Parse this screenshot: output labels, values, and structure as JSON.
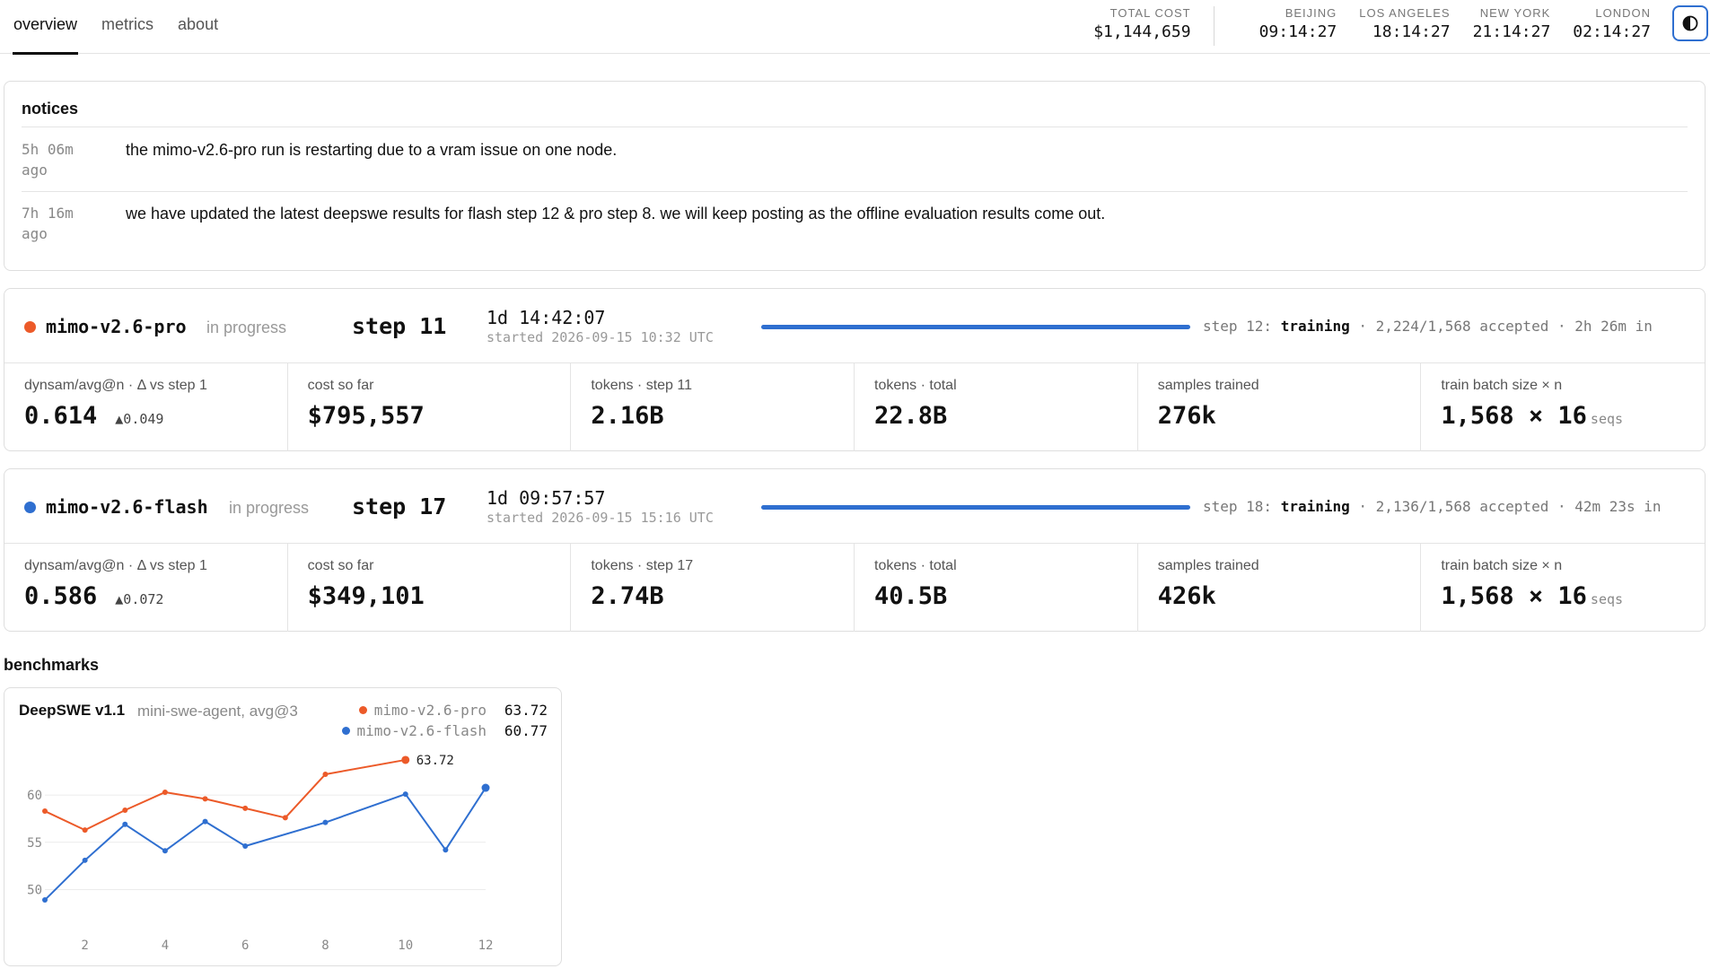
{
  "nav": {
    "tabs": [
      {
        "label": "overview",
        "active": true
      },
      {
        "label": "metrics",
        "active": false
      },
      {
        "label": "about",
        "active": false
      }
    ]
  },
  "header": {
    "total_cost_label": "TOTAL COST",
    "total_cost_value": "$1,144,659",
    "clocks": [
      {
        "label": "BEIJING",
        "time": "09:14:27"
      },
      {
        "label": "LOS ANGELES",
        "time": "18:14:27"
      },
      {
        "label": "NEW YORK",
        "time": "21:14:27"
      },
      {
        "label": "LONDON",
        "time": "02:14:27"
      }
    ],
    "theme_toggle_icon": "half-circle-contrast-icon"
  },
  "notices": {
    "title": "notices",
    "items": [
      {
        "time": "5h 06m ago",
        "text": "the mimo-v2.6-pro run is restarting due to a vram issue on one node."
      },
      {
        "time": "7h 16m ago",
        "text": "we have updated the latest deepswe results for flash step 12 & pro step 8. we will keep posting as the offline evaluation results come out."
      }
    ]
  },
  "runs": [
    {
      "name": "mimo-v2.6-pro",
      "dot_color": "#ec5a29",
      "status": "in progress",
      "step": "step 11",
      "elapsed": "1d 14:42:07",
      "started": "started 2026-09-15 10:32 UTC",
      "progress_fraction": 1.0,
      "progress_prefix": "step 12:",
      "progress_phase": "training",
      "progress_suffix": "· 2,224/1,568 accepted · 2h 26m in",
      "metrics": [
        {
          "label": "dynsam/avg@n · Δ vs step 1",
          "value": "0.614",
          "delta": "▲0.049"
        },
        {
          "label": "cost so far",
          "value": "$795,557"
        },
        {
          "label": "tokens · step 11",
          "value": "2.16B"
        },
        {
          "label": "tokens · total",
          "value": "22.8B"
        },
        {
          "label": "samples trained",
          "value": "276k"
        },
        {
          "label": "train batch size × n",
          "value": "1,568 × 16",
          "unit": "seqs"
        }
      ]
    },
    {
      "name": "mimo-v2.6-flash",
      "dot_color": "#2f6fd0",
      "status": "in progress",
      "step": "step 17",
      "elapsed": "1d 09:57:57",
      "started": "started 2026-09-15 15:16 UTC",
      "progress_fraction": 1.0,
      "progress_prefix": "step 18:",
      "progress_phase": "training",
      "progress_suffix": "· 2,136/1,568 accepted · 42m 23s in",
      "metrics": [
        {
          "label": "dynsam/avg@n · Δ vs step 1",
          "value": "0.586",
          "delta": "▲0.072"
        },
        {
          "label": "cost so far",
          "value": "$349,101"
        },
        {
          "label": "tokens · step 17",
          "value": "2.74B"
        },
        {
          "label": "tokens · total",
          "value": "40.5B"
        },
        {
          "label": "samples trained",
          "value": "426k"
        },
        {
          "label": "train batch size × n",
          "value": "1,568 × 16",
          "unit": "seqs"
        }
      ]
    }
  ],
  "benchmarks": {
    "section_title": "benchmarks",
    "card_title": "DeepSWE v1.1",
    "card_subtitle": "mini-swe-agent, avg@3",
    "legend": [
      {
        "name": "mimo-v2.6-pro",
        "value": "63.72",
        "color": "#ec5a29"
      },
      {
        "name": "mimo-v2.6-flash",
        "value": "60.77",
        "color": "#2f6fd0"
      }
    ]
  },
  "chart_data": {
    "type": "line",
    "title": "DeepSWE v1.1",
    "subtitle": "mini-swe-agent, avg@3",
    "xlabel": "",
    "ylabel": "",
    "xlim": [
      1,
      12
    ],
    "ylim": [
      49,
      64
    ],
    "xticks": [
      2,
      4,
      6,
      8,
      10,
      12
    ],
    "yticks": [
      50,
      55,
      60
    ],
    "grid": true,
    "series": [
      {
        "name": "mimo-v2.6-pro",
        "color": "#ec5a29",
        "x": [
          1,
          2,
          3,
          4,
          5,
          6,
          7,
          8,
          10
        ],
        "y": [
          58.3,
          56.3,
          58.4,
          60.3,
          59.6,
          58.6,
          57.6,
          62.2,
          63.72
        ],
        "end_label": "63.72"
      },
      {
        "name": "mimo-v2.6-flash",
        "color": "#2f6fd0",
        "x": [
          1,
          2,
          3,
          4,
          5,
          6,
          8,
          10,
          11,
          12
        ],
        "y": [
          48.9,
          53.1,
          56.9,
          54.1,
          57.2,
          54.6,
          57.1,
          60.1,
          54.2,
          60.77
        ]
      }
    ]
  }
}
